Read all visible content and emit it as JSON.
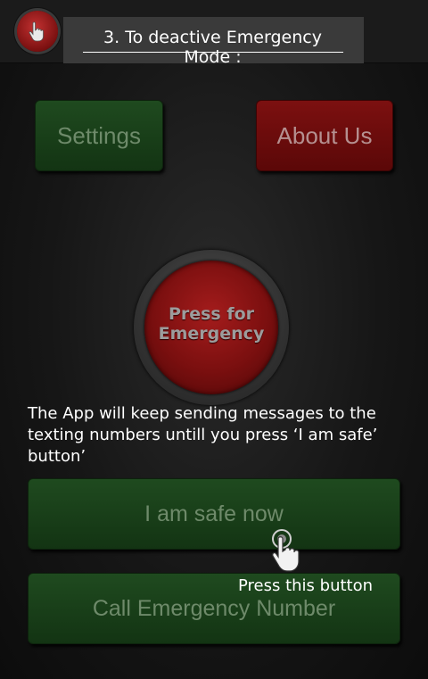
{
  "header": {
    "step_title": "3. To deactive Emergency Mode :"
  },
  "buttons": {
    "settings_label": "Settings",
    "about_label": "About Us",
    "emergency_line1": "Press for",
    "emergency_line2": "Emergency",
    "safe_label": "I am safe now",
    "call_label": "Call Emergency Number"
  },
  "tutorial": {
    "instruction_text": "The App will keep sending messages to the texting numbers untill you press ‘I am safe’ button’",
    "pointer_label": "Press this button"
  },
  "icons": {
    "app_icon": "hand-pointer-icon",
    "pointer": "hand-pointer-icon"
  },
  "colors": {
    "green_button": "#1a3f1a",
    "red_button": "#6b0c0c",
    "emergency_red": "#8f1515",
    "background": "#141414"
  }
}
